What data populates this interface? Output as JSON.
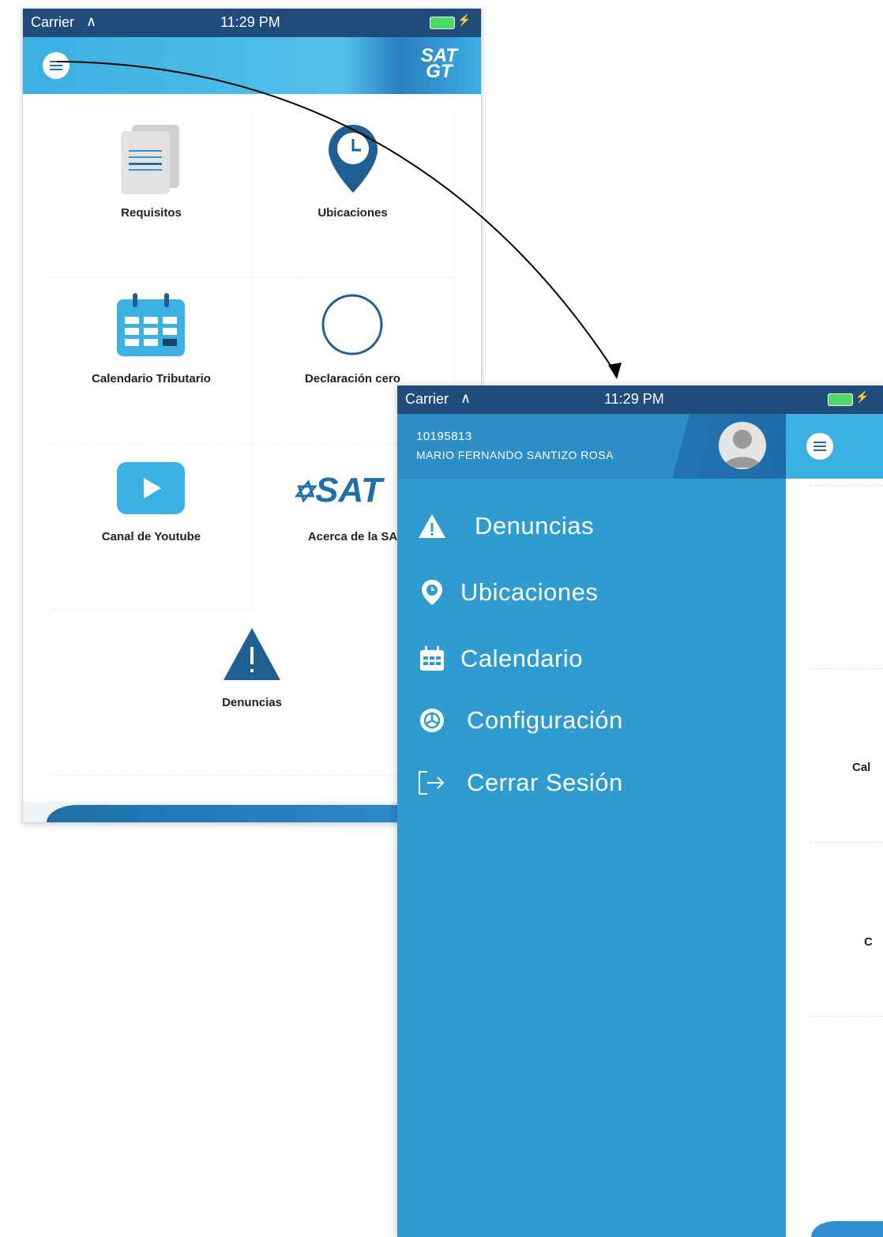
{
  "status_bar": {
    "carrier": "Carrier",
    "time": "11:29 PM"
  },
  "home": {
    "logo": {
      "line1": "SAT",
      "line2": "GT"
    },
    "tiles": [
      {
        "label": "Requisitos",
        "icon": "documents-icon"
      },
      {
        "label": "Ubicaciones",
        "icon": "location-clock-icon"
      },
      {
        "label": "Calendario Tributario",
        "icon": "calendar-icon"
      },
      {
        "label": "Declaración cero",
        "icon": "circle-icon"
      },
      {
        "label": "Canal de Youtube",
        "icon": "youtube-play-icon"
      },
      {
        "label": "Acerca de la SA",
        "icon": "sat-logo-icon",
        "logo_text": "SAT"
      },
      {
        "label": "Denuncias",
        "icon": "warning-icon"
      }
    ]
  },
  "drawer": {
    "user_id": "10195813",
    "user_name": "MARIO FERNANDO SANTIZO ROSA",
    "items": [
      {
        "label": "Denuncias",
        "icon": "warning-icon"
      },
      {
        "label": "Ubicaciones",
        "icon": "location-pin-icon"
      },
      {
        "label": "Calendario",
        "icon": "calendar-icon"
      },
      {
        "label": "Configuración",
        "icon": "gear-icon"
      },
      {
        "label": "Cerrar Sesión",
        "icon": "logout-icon"
      }
    ]
  },
  "peek": {
    "label1": "Cal",
    "label2": "C"
  },
  "colors": {
    "nav_blue": "#3bb0e3",
    "status_bar": "#1f4c7b",
    "drawer_blue": "#2e9cd1",
    "icon_blue": "#1f6fa8"
  }
}
